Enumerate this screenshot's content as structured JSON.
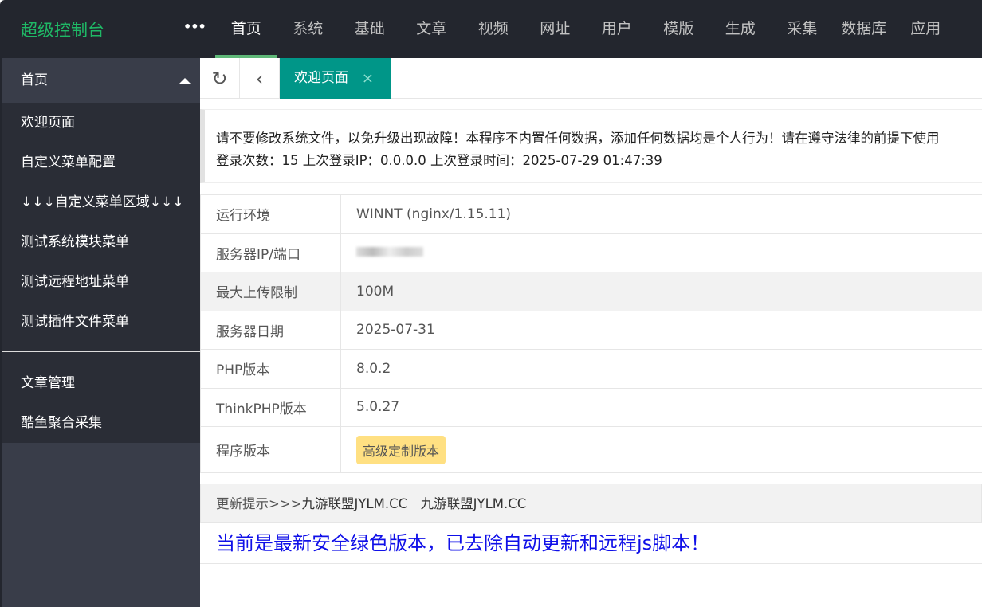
{
  "header": {
    "logo": "超级控制台",
    "more": "•••",
    "nav": [
      "首页",
      "系统",
      "基础",
      "文章",
      "视频",
      "网址",
      "用户",
      "模版",
      "生成",
      "采集",
      "数据库",
      "应用"
    ]
  },
  "sidebar": {
    "head": "首页",
    "group1": [
      "欢迎页面",
      "自定义菜单配置",
      "↓↓↓自定义菜单区域↓↓↓",
      "测试系统模块菜单",
      "测试远程地址菜单",
      "测试插件文件菜单"
    ],
    "group2": [
      "文章管理",
      "酷鱼聚合采集"
    ]
  },
  "tabs": {
    "active": "欢迎页面",
    "close": "×"
  },
  "notice": {
    "line1": "请不要修改系统文件，以免升级出现故障！本程序不内置任何数据，添加任何数据均是个人行为！请在遵守法律的前提下使用",
    "line2": "登录次数：15 上次登录IP：0.0.0.0 上次登录时间：2025-07-29 01:47:39"
  },
  "info": [
    {
      "k": "运行环境",
      "v": "WINNT (nginx/1.15.11)"
    },
    {
      "k": "服务器IP/端口",
      "v": ""
    },
    {
      "k": "最大上传限制",
      "v": "100M"
    },
    {
      "k": "服务器日期",
      "v": "2025-07-31"
    },
    {
      "k": "PHP版本",
      "v": "8.0.2"
    },
    {
      "k": "ThinkPHP版本",
      "v": "5.0.27"
    },
    {
      "k": "程序版本",
      "v": "高级定制版本"
    }
  ],
  "update": {
    "label": "更新提示>>>",
    "links": "九游联盟JYLM.CC　九游联盟JYLM.CC"
  },
  "safe_text": "当前是最新安全绿色版本，已去除自动更新和远程js脚本！"
}
